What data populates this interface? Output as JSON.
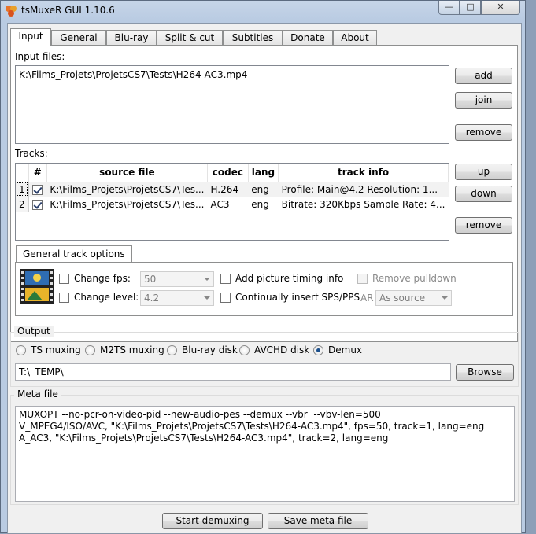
{
  "window": {
    "title": "tsMuxeR GUI 1.10.6",
    "minimize": "—",
    "maximize": "□",
    "close": "✕"
  },
  "tabs": [
    "Input",
    "General",
    "Blu-ray",
    "Split & cut",
    "Subtitles",
    "Donate",
    "About"
  ],
  "input": {
    "files_label": "Input files:",
    "files": [
      "K:\\Films_Projets\\ProjetsCS7\\Tests\\H264-AC3.mp4"
    ],
    "add_label": "add",
    "join_label": "join",
    "remove_label": "remove"
  },
  "tracks": {
    "label": "Tracks:",
    "columns": [
      "#",
      "source file",
      "codec",
      "lang",
      "track info"
    ],
    "rows": [
      {
        "n": "1",
        "checked": true,
        "source": "K:\\Films_Projets\\ProjetsCS7\\Tes...",
        "codec": "H.264",
        "lang": "eng",
        "info": "Profile: Main@4.2  Resolution: 1..."
      },
      {
        "n": "2",
        "checked": true,
        "source": "K:\\Films_Projets\\ProjetsCS7\\Tes...",
        "codec": "AC3",
        "lang": "eng",
        "info": "Bitrate: 320Kbps Sample Rate: 4..."
      }
    ],
    "up_label": "up",
    "down_label": "down",
    "remove_label": "remove"
  },
  "general_track_options": {
    "tab_label": "General track options",
    "change_fps_label": "Change fps:",
    "fps_value": "50",
    "change_level_label": "Change level:",
    "level_value": "4.2",
    "add_picture_timing_label": "Add picture timing info",
    "continually_insert_label": "Continually insert SPS/PPS",
    "remove_pulldown_label": "Remove pulldown",
    "ar_label": "AR",
    "ar_value": "As source"
  },
  "output": {
    "title": "Output",
    "modes": [
      "TS muxing",
      "M2TS muxing",
      "Blu-ray disk",
      "AVCHD disk",
      "Demux"
    ],
    "selected_mode": "Demux",
    "path": "T:\\_TEMP\\",
    "browse_label": "Browse"
  },
  "meta": {
    "title": "Meta file",
    "lines": [
      "MUXOPT --no-pcr-on-video-pid --new-audio-pes --demux --vbr  --vbv-len=500",
      "V_MPEG4/ISO/AVC, \"K:\\Films_Projets\\ProjetsCS7\\Tests\\H264-AC3.mp4\", fps=50, track=1, lang=eng",
      "A_AC3, \"K:\\Films_Projets\\ProjetsCS7\\Tests\\H264-AC3.mp4\", track=2, lang=eng"
    ]
  },
  "actions": {
    "start_label": "Start demuxing",
    "save_meta_label": "Save meta file"
  },
  "colors": {
    "title_bar": "#c6d5e8",
    "selected_radio": "#1b4f8c",
    "film_icon_blue": "#2f6db3",
    "film_icon_yellow": "#e8b42a"
  }
}
